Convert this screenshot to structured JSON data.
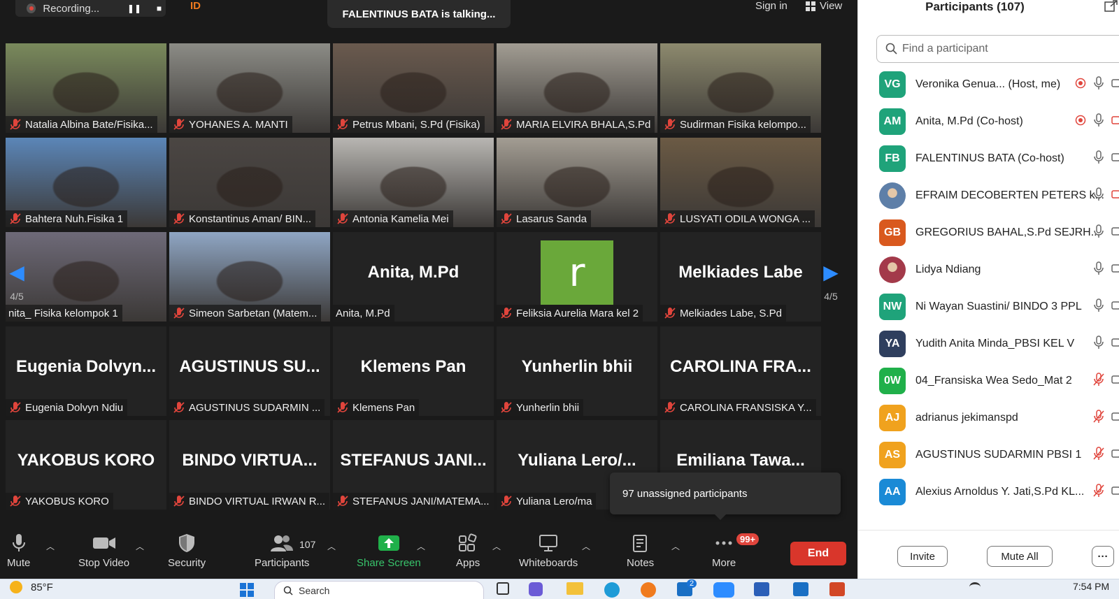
{
  "top": {
    "recording_label": "Recording...",
    "id_label": "ID",
    "talking": "FALENTINUS BATA is talking...",
    "signin": "Sign in",
    "view": "View"
  },
  "tiles": [
    {
      "name": "Natalia Albina Bate/Fisika...",
      "muted": true,
      "kind": "video",
      "bg": "#7a8a5c"
    },
    {
      "name": "YOHANES A. MANTI",
      "muted": true,
      "kind": "video",
      "bg": "#8c8c86"
    },
    {
      "name": "Petrus Mbani, S.Pd (Fisika)",
      "muted": true,
      "kind": "video",
      "bg": "#6a5a4e"
    },
    {
      "name": "MARIA ELVIRA BHALA,S.Pd",
      "muted": true,
      "kind": "video",
      "bg": "#a29d93"
    },
    {
      "name": "Sudirman Fisika kelompo...",
      "muted": true,
      "kind": "video",
      "bg": "#8d8a6e"
    },
    {
      "name": "Bahtera Nuh.Fisika 1",
      "muted": true,
      "kind": "video",
      "bg": "#5b86b8"
    },
    {
      "name": "Konstantinus Aman/ BIN...",
      "muted": true,
      "kind": "video",
      "bg": "#4b4643"
    },
    {
      "name": "Antonia Kamelia Mei",
      "muted": true,
      "kind": "video",
      "bg": "#b8b6b2"
    },
    {
      "name": "Lasarus Sanda",
      "muted": true,
      "kind": "video",
      "bg": "#a39d93"
    },
    {
      "name": "LUSYATI ODILA WONGA ...",
      "muted": true,
      "kind": "video",
      "bg": "#6b5a44"
    },
    {
      "name": "nita_ Fisika kelompok 1",
      "muted": false,
      "kind": "video",
      "bg": "#6e6a78"
    },
    {
      "name": "Simeon Sarbetan (Matem...",
      "muted": true,
      "kind": "video",
      "bg": "#8fa6c4"
    },
    {
      "name": "Anita, M.Pd",
      "muted": false,
      "kind": "text",
      "big": "Anita, M.Pd"
    },
    {
      "name": "Feliksia Aurelia Mara kel 2",
      "muted": true,
      "kind": "avatar",
      "letter": "r"
    },
    {
      "name": "Melkiades Labe, S.Pd",
      "muted": true,
      "kind": "text",
      "big": "Melkiades  Labe"
    },
    {
      "name": "Eugenia Dolvyn Ndiu",
      "muted": true,
      "kind": "text",
      "big": "Eugenia  Dolvyn..."
    },
    {
      "name": "AGUSTINUS SUDARMIN ...",
      "muted": true,
      "kind": "text",
      "big": "AGUSTINUS  SU..."
    },
    {
      "name": "Klemens Pan",
      "muted": true,
      "kind": "text",
      "big": "Klemens Pan"
    },
    {
      "name": "Yunherlin bhii",
      "muted": true,
      "kind": "text",
      "big": "Yunherlin bhii"
    },
    {
      "name": "CAROLINA FRANSISKA Y...",
      "muted": true,
      "kind": "text",
      "big": "CAROLINA  FRA..."
    },
    {
      "name": "YAKOBUS KORO",
      "muted": true,
      "kind": "text",
      "big": "YAKOBUS KORO"
    },
    {
      "name": "BINDO VIRTUAL IRWAN R...",
      "muted": true,
      "kind": "text",
      "big": "BINDO  VIRTUA..."
    },
    {
      "name": "STEFANUS JANI/MATEMA...",
      "muted": true,
      "kind": "text",
      "big": "STEFANUS  JANI..."
    },
    {
      "name": "Yuliana Lero/ma",
      "muted": true,
      "kind": "text",
      "big": "Yuliana  Lero/..."
    },
    {
      "name": "",
      "muted": false,
      "kind": "text",
      "big": "Emiliana  Tawa..."
    }
  ],
  "pager": {
    "left": "4/5",
    "right": "4/5"
  },
  "tooltip": "97 unassigned participants",
  "toolbar": {
    "mute": "Mute",
    "stop_video": "Stop Video",
    "security": "Security",
    "participants": "Participants",
    "participants_count": "107",
    "share_screen": "Share Screen",
    "apps": "Apps",
    "whiteboards": "Whiteboards",
    "notes": "Notes",
    "more": "More",
    "more_badge": "99+",
    "end": "End"
  },
  "panel": {
    "title": "Participants (107)",
    "search_placeholder": "Find a participant",
    "invite": "Invite",
    "mute_all": "Mute All",
    "more": "···",
    "participants": [
      {
        "initials": "VG",
        "color": "#1fa37a",
        "name": "Veronika Genua...  (Host, me)",
        "rec": true,
        "mic": "on",
        "video": "on"
      },
      {
        "initials": "AM",
        "color": "#1fa37a",
        "name": "Anita, M.Pd (Co-host)",
        "rec": true,
        "mic": "on",
        "video": "off"
      },
      {
        "initials": "FB",
        "color": "#1fa37a",
        "name": "FALENTINUS BATA (Co-host)",
        "rec": false,
        "mic": "on",
        "video": "on"
      },
      {
        "initials": "",
        "color": "#5e7fa8",
        "name": "EFRAIM DECOBERTEN PETERS k...",
        "rec": false,
        "mic": "on",
        "video": "off",
        "photo": true
      },
      {
        "initials": "GB",
        "color": "#d9591e",
        "name": "GREGORIUS BAHAL,S.Pd SEJRH...",
        "rec": false,
        "mic": "on",
        "video": "on"
      },
      {
        "initials": "",
        "color": "#a33a4a",
        "name": "Lidya Ndiang",
        "rec": false,
        "mic": "on",
        "video": "on",
        "photo": true
      },
      {
        "initials": "NW",
        "color": "#1fa37a",
        "name": "Ni Wayan Suastini/ BINDO 3 PPL",
        "rec": false,
        "mic": "on",
        "video": "on"
      },
      {
        "initials": "YA",
        "color": "#2f3f5e",
        "name": "Yudith Anita Minda_PBSI KEL V",
        "rec": false,
        "mic": "on",
        "video": "on"
      },
      {
        "initials": "0W",
        "color": "#20b04a",
        "name": "04_Fransiska Wea Sedo_Mat 2",
        "rec": false,
        "mic": "off",
        "video": "on"
      },
      {
        "initials": "AJ",
        "color": "#f0a21e",
        "name": "adrianus jekimanspd",
        "rec": false,
        "mic": "off",
        "video": "on"
      },
      {
        "initials": "AS",
        "color": "#f0a21e",
        "name": "AGUSTINUS SUDARMIN PBSI 1",
        "rec": false,
        "mic": "off",
        "video": "on"
      },
      {
        "initials": "AA",
        "color": "#1a8ad6",
        "name": "Alexius Arnoldus Y. Jati,S.Pd KL...",
        "rec": false,
        "mic": "off",
        "video": "on"
      }
    ]
  },
  "taskbar": {
    "temp": "85°F",
    "search": "Search",
    "badge": "2",
    "time": "7:54 PM"
  }
}
